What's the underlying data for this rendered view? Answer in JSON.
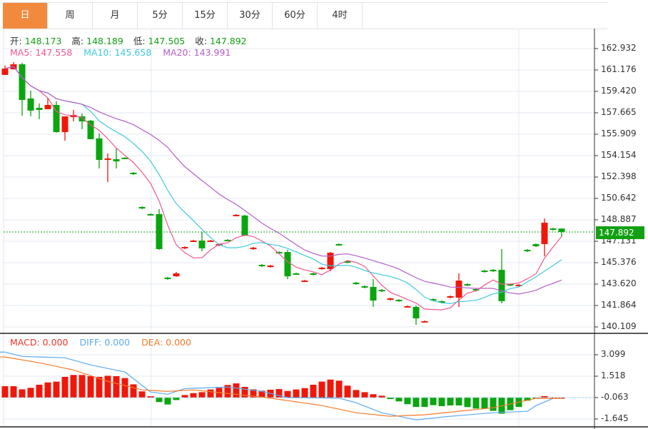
{
  "tabs": [
    {
      "label": "日",
      "active": true
    },
    {
      "label": "周"
    },
    {
      "label": "月"
    },
    {
      "label": "5分"
    },
    {
      "label": "15分"
    },
    {
      "label": "30分"
    },
    {
      "label": "60分"
    },
    {
      "label": "4时"
    }
  ],
  "ohlc_legend": {
    "open_label": "开:",
    "open": "148.173",
    "high_label": "高:",
    "high": "148.189",
    "low_label": "低:",
    "low": "147.505",
    "close_label": "收:",
    "close": "147.892"
  },
  "ma_legend": {
    "ma5": "MA5: 147.558",
    "ma10": "MA10: 145.658",
    "ma20": "MA20: 143.991"
  },
  "macd_legend": {
    "macd": "MACD: 0.000",
    "diff": "DIFF: 0.000",
    "dea": "DEA: 0.000"
  },
  "current_price": "147.892",
  "colors": {
    "up": "#f0170a",
    "down": "#0aa50f",
    "ma5": "#f0578d",
    "ma10": "#3fc8dc",
    "ma20": "#b35ec9",
    "diff": "#5aaaf0",
    "dea": "#f57a28",
    "accent": "#f28a3e"
  },
  "chart_data": {
    "type": "candlestick",
    "price_axis": {
      "range": [
        140.109,
        162.932
      ],
      "ticks": [
        "162.932",
        "161.176",
        "159.420",
        "157.665",
        "155.909",
        "154.154",
        "152.398",
        "150.642",
        "148.887",
        "147.131",
        "145.376",
        "143.620",
        "141.864",
        "140.109"
      ]
    },
    "candles": [
      [
        160.77,
        161.29,
        161.53,
        160.77
      ],
      [
        161.23,
        161.64,
        161.82,
        161.23
      ],
      [
        161.64,
        158.72,
        161.76,
        157.43
      ],
      [
        158.84,
        157.84,
        159.48,
        157.37
      ],
      [
        158.07,
        157.9,
        158.43,
        157.14
      ],
      [
        157.96,
        158.31,
        158.89,
        157.96
      ],
      [
        158.31,
        156.08,
        158.6,
        156.03
      ],
      [
        156.08,
        157.37,
        157.37,
        155.38
      ],
      [
        157.31,
        157.49,
        157.9,
        156.96
      ],
      [
        157.37,
        156.96,
        157.61,
        156.32
      ],
      [
        157.02,
        155.5,
        157.08,
        155.5
      ],
      [
        155.56,
        153.8,
        155.97,
        153.1
      ],
      [
        153.8,
        153.92,
        154.33,
        151.99
      ],
      [
        153.86,
        153.68,
        154.74,
        153.1
      ],
      [
        153.98,
        153.92,
        154.02,
        153.86
      ],
      [
        152.75,
        152.63,
        152.81,
        152.57
      ],
      [
        149.94,
        149.82,
        150.0,
        149.76
      ],
      [
        149.36,
        149.3,
        149.42,
        149.24
      ],
      [
        149.36,
        146.49,
        149.77,
        146.43
      ],
      [
        144.15,
        144.03,
        144.21,
        143.97
      ],
      [
        144.26,
        144.5,
        144.62,
        144.2
      ],
      [
        146.55,
        146.66,
        146.72,
        146.49
      ],
      [
        147.13,
        147.19,
        147.25,
        147.07
      ],
      [
        147.19,
        146.55,
        147.89,
        146.31
      ],
      [
        147.13,
        147.19,
        147.25,
        147.07
      ],
      [
        146.78,
        146.9,
        146.96,
        146.72
      ],
      [
        147.25,
        147.19,
        147.31,
        147.13
      ],
      [
        149.24,
        149.3,
        149.36,
        149.18
      ],
      [
        149.24,
        147.6,
        149.3,
        147.54
      ],
      [
        146.49,
        146.61,
        146.67,
        146.43
      ],
      [
        145.2,
        145.08,
        145.26,
        145.02
      ],
      [
        145.02,
        145.14,
        145.2,
        144.96
      ],
      [
        146.25,
        146.14,
        146.31,
        146.08
      ],
      [
        146.25,
        144.26,
        146.43,
        144.03
      ],
      [
        144.5,
        144.44,
        144.56,
        144.38
      ],
      [
        143.86,
        143.91,
        143.97,
        143.8
      ],
      [
        144.5,
        144.38,
        144.56,
        144.32
      ],
      [
        144.85,
        144.97,
        145.03,
        144.79
      ],
      [
        144.85,
        146.19,
        146.25,
        144.67
      ],
      [
        146.9,
        146.84,
        146.96,
        146.78
      ],
      [
        145.49,
        145.38,
        145.55,
        145.32
      ],
      [
        143.74,
        143.62,
        143.8,
        143.56
      ],
      [
        143.45,
        143.33,
        143.51,
        143.27
      ],
      [
        143.39,
        142.27,
        144.03,
        141.75
      ],
      [
        143.15,
        143.03,
        143.21,
        142.97
      ],
      [
        142.33,
        142.45,
        142.51,
        142.27
      ],
      [
        142.33,
        142.22,
        142.39,
        142.16
      ],
      [
        141.75,
        141.81,
        141.87,
        141.69
      ],
      [
        141.75,
        140.81,
        141.86,
        140.28
      ],
      [
        140.52,
        140.58,
        140.64,
        140.46
      ],
      [
        142.39,
        142.27,
        142.45,
        142.21
      ],
      [
        142.22,
        142.1,
        142.28,
        142.04
      ],
      [
        142.51,
        142.63,
        142.69,
        142.45
      ],
      [
        142.51,
        143.91,
        144.5,
        141.75
      ],
      [
        143.62,
        143.5,
        143.68,
        143.44
      ],
      [
        143.21,
        143.09,
        143.27,
        143.03
      ],
      [
        144.73,
        144.62,
        144.79,
        144.56
      ],
      [
        144.79,
        144.67,
        144.85,
        144.61
      ],
      [
        144.79,
        142.22,
        146.49,
        142.04
      ],
      [
        143.62,
        143.5,
        143.68,
        143.44
      ],
      [
        143.5,
        143.56,
        143.62,
        143.44
      ],
      [
        146.43,
        146.31,
        146.49,
        146.25
      ],
      [
        146.9,
        146.72,
        146.96,
        146.66
      ],
      [
        146.9,
        148.65,
        149.0,
        145.9
      ],
      [
        148.18,
        148.07,
        148.24,
        148.01
      ],
      [
        148.173,
        147.892,
        148.189,
        147.505
      ]
    ],
    "ma_periods": [
      5,
      10,
      20
    ],
    "macd_axis": {
      "range": [
        -1.95,
        3.7
      ],
      "ticks": [
        "3.099",
        "1.518",
        "-0.063",
        "-1.645"
      ],
      "tick_values": [
        3.099,
        1.518,
        -0.063,
        -1.645
      ]
    },
    "macd_hist": [
      0.84,
      0.84,
      0.61,
      0.72,
      0.95,
      1.12,
      1.18,
      1.53,
      1.67,
      1.67,
      1.58,
      1.53,
      1.61,
      1.58,
      1.44,
      0.98,
      0.46,
      0.1,
      -0.33,
      -0.51,
      -0.18,
      0.19,
      0.33,
      0.4,
      0.6,
      0.72,
      0.93,
      1.05,
      0.79,
      0.61,
      0.51,
      0.58,
      0.63,
      0.49,
      0.6,
      0.7,
      0.95,
      1.18,
      1.33,
      1.25,
      0.88,
      0.56,
      0.4,
      0.25,
      0.14,
      -0.11,
      -0.28,
      -0.49,
      -0.69,
      -0.69,
      -0.56,
      -0.63,
      -0.58,
      -0.58,
      -0.7,
      -0.81,
      -0.81,
      -0.98,
      -1.19,
      -0.93,
      -0.69,
      -0.23,
      -0.05,
      0.11,
      0.02,
      0.0
    ],
    "diff_points": [
      [
        0,
        3.36
      ],
      [
        2,
        3.04
      ],
      [
        7,
        2.94
      ],
      [
        10,
        2.41
      ],
      [
        14,
        1.89
      ],
      [
        17,
        0.41
      ],
      [
        19,
        0.25
      ],
      [
        21,
        0.67
      ],
      [
        26,
        0.78
      ],
      [
        30,
        0.46
      ],
      [
        33,
        0.0
      ],
      [
        39,
        -0.04
      ],
      [
        41,
        -0.38
      ],
      [
        44,
        -1.12
      ],
      [
        48,
        -1.64
      ],
      [
        52,
        -1.38
      ],
      [
        57,
        -1.12
      ],
      [
        61,
        -1.01
      ],
      [
        62,
        -0.59
      ],
      [
        64,
        -0.06
      ],
      [
        65,
        -0.06
      ]
    ],
    "dea_points": [
      [
        0,
        3.0
      ],
      [
        4,
        2.57
      ],
      [
        8,
        2.04
      ],
      [
        12,
        1.2
      ],
      [
        16,
        0.57
      ],
      [
        19,
        0.46
      ],
      [
        22,
        0.57
      ],
      [
        26,
        0.3
      ],
      [
        30,
        0.04
      ],
      [
        33,
        -0.22
      ],
      [
        37,
        -0.59
      ],
      [
        41,
        -1.12
      ],
      [
        45,
        -1.38
      ],
      [
        49,
        -1.27
      ],
      [
        53,
        -1.01
      ],
      [
        57,
        -0.75
      ],
      [
        60,
        -0.33
      ],
      [
        62,
        -0.06
      ],
      [
        65,
        -0.06
      ]
    ]
  }
}
